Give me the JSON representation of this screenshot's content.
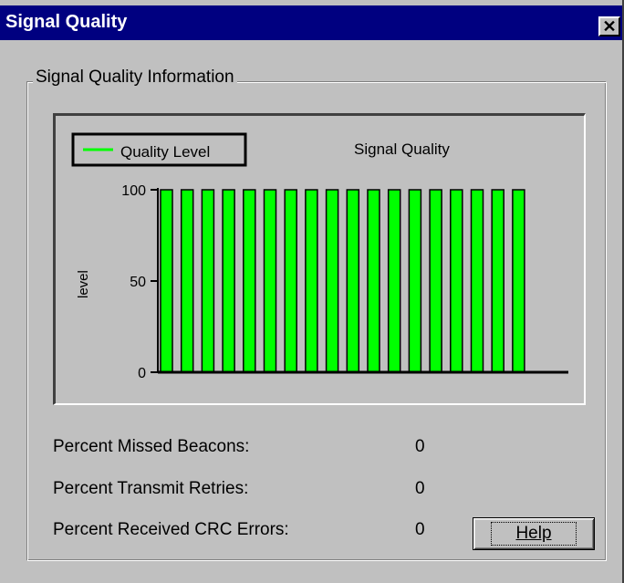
{
  "window": {
    "title": "Signal Quality",
    "close_icon": "close-icon"
  },
  "group": {
    "label": "Signal Quality Information"
  },
  "chart": {
    "legend_label": "Quality Level",
    "title": "Signal Quality",
    "ylabel": "level",
    "series_color": "#00ff00"
  },
  "chart_data": {
    "type": "bar",
    "title": "Signal Quality",
    "ylabel": "level",
    "xlabel": "",
    "ylim": [
      0,
      100
    ],
    "yticks": [
      "100",
      "50",
      "0"
    ],
    "series": [
      {
        "name": "Quality Level",
        "values": [
          100,
          100,
          100,
          100,
          100,
          100,
          100,
          100,
          100,
          100,
          100,
          100,
          100,
          100,
          100,
          100,
          100,
          100
        ]
      }
    ],
    "legend": "top-left",
    "grid": false
  },
  "stats": [
    {
      "label": "Percent Missed Beacons:",
      "value": "0"
    },
    {
      "label": "Percent Transmit Retries:",
      "value": "0"
    },
    {
      "label": "Percent Received CRC Errors:",
      "value": "0"
    }
  ],
  "buttons": {
    "help": "Help"
  }
}
